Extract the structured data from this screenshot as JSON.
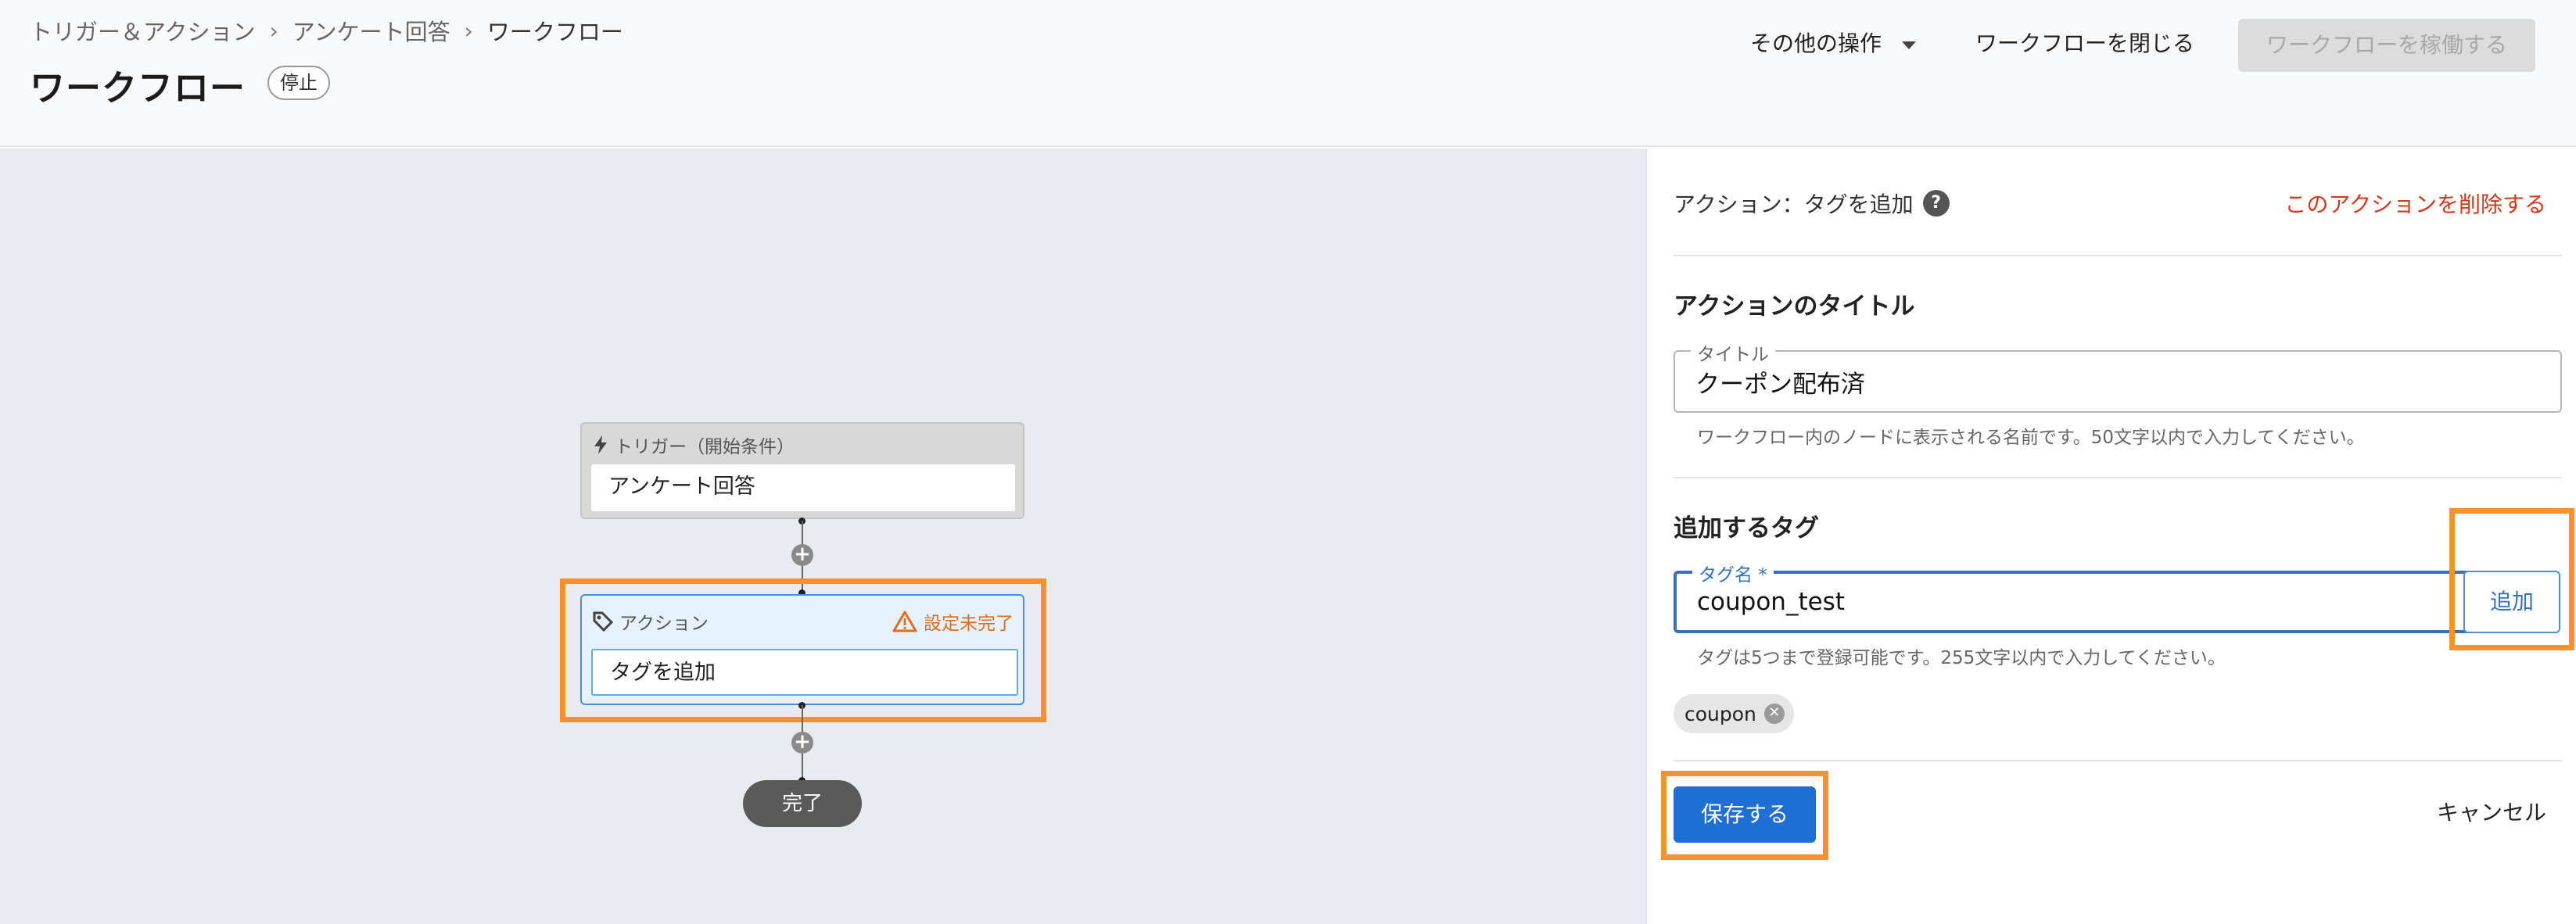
{
  "breadcrumb": [
    "トリガー＆アクション",
    "アンケート回答",
    "ワークフロー"
  ],
  "breadcrumb_sep": "›",
  "page": {
    "title": "ワークフロー",
    "status": "停止"
  },
  "header": {
    "more_ops": "その他の操作",
    "close_workflow": "ワークフローを閉じる",
    "run_workflow": "ワークフローを稼働する"
  },
  "canvas": {
    "trigger": {
      "header": "トリガー（開始条件）",
      "label": "アンケート回答"
    },
    "action": {
      "header": "アクション",
      "warning": "設定未完了",
      "label": "タグを追加"
    },
    "end": "完了",
    "plus": "+"
  },
  "panel": {
    "title": "アクション：タグを追加",
    "help": "?",
    "delete": "このアクションを削除する",
    "title_section": {
      "heading": "アクションのタイトル",
      "field_label": "タイトル",
      "value": "クーポン配布済",
      "helper": "ワークフロー内のノードに表示される名前です。50文字以内で入力してください。"
    },
    "tag_section": {
      "heading": "追加するタグ",
      "field_label": "タグ名 *",
      "value": "coupon_test",
      "add_button": "追加",
      "helper": "タグは5つまで登録可能です。255文字以内で入力してください。",
      "chips": [
        "coupon"
      ]
    },
    "save": "保存する",
    "cancel": "キャンセル"
  },
  "colors": {
    "primary": "#1f6ed4",
    "highlight": "#f5922f",
    "danger": "#d2391c",
    "warning": "#e06c1c"
  }
}
